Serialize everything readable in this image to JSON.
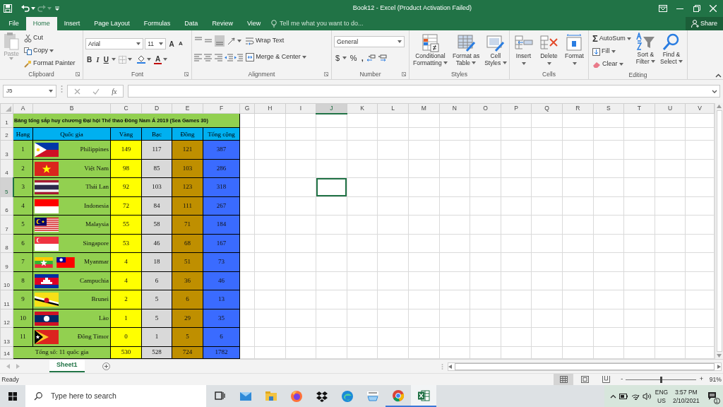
{
  "window": {
    "title": "Book12 - Excel (Product Activation Failed)"
  },
  "ribbon_tabs": [
    {
      "label": "File",
      "selected": false
    },
    {
      "label": "Home",
      "selected": true
    },
    {
      "label": "Insert",
      "selected": false
    },
    {
      "label": "Page Layout",
      "selected": false
    },
    {
      "label": "Formulas",
      "selected": false
    },
    {
      "label": "Data",
      "selected": false
    },
    {
      "label": "Review",
      "selected": false
    },
    {
      "label": "View",
      "selected": false
    }
  ],
  "tell_me": {
    "placeholder": "Tell me what you want to do..."
  },
  "share": "Share",
  "clipboard": {
    "paste": "Paste",
    "cut": "Cut",
    "copy": "Copy",
    "format_painter": "Format Painter",
    "label": "Clipboard"
  },
  "font": {
    "name": "Arial",
    "size": "11",
    "grow": "A",
    "shrink": "A",
    "bold": "B",
    "italic": "I",
    "underline": "U",
    "font_color": "A",
    "label": "Font"
  },
  "alignment": {
    "wrap_text": "Wrap Text",
    "merge_center": "Merge & Center",
    "label": "Alignment"
  },
  "number": {
    "format": "General",
    "currency": "$",
    "percent": "%",
    "comma": ",",
    "label": "Number"
  },
  "styles": {
    "label": "Styles",
    "buttons": [
      {
        "kind": "conditional",
        "lines": [
          "Conditional",
          "Formatting"
        ]
      },
      {
        "kind": "table",
        "lines": [
          "Format as",
          "Table"
        ]
      },
      {
        "kind": "cellstyles",
        "lines": [
          "Cell",
          "Styles"
        ]
      }
    ]
  },
  "cells": {
    "label": "Cells",
    "buttons": [
      {
        "kind": "insert",
        "lines": [
          "Insert"
        ]
      },
      {
        "kind": "delete",
        "lines": [
          "Delete"
        ]
      },
      {
        "kind": "format",
        "lines": [
          "Format"
        ]
      }
    ]
  },
  "editing": {
    "label": "Editing",
    "autosum_symbol": "Σ",
    "autosum": "AutoSum",
    "fill": "Fill",
    "clear": "Clear",
    "buttons": [
      {
        "kind": "sort",
        "lines": [
          "Sort &",
          "Filter"
        ]
      },
      {
        "kind": "find",
        "lines": [
          "Find &",
          "Select"
        ]
      }
    ]
  },
  "name_box": "J5",
  "fx": "fx",
  "columns": [
    {
      "label": "A",
      "selected": false
    },
    {
      "label": "B",
      "selected": false
    },
    {
      "label": "C",
      "selected": false
    },
    {
      "label": "D",
      "selected": false
    },
    {
      "label": "E",
      "selected": false
    },
    {
      "label": "F",
      "selected": false
    },
    {
      "label": "G",
      "selected": false
    },
    {
      "label": "H",
      "selected": false
    },
    {
      "label": "I",
      "selected": false
    },
    {
      "label": "J",
      "selected": true
    },
    {
      "label": "K",
      "selected": false
    },
    {
      "label": "L",
      "selected": false
    },
    {
      "label": "M",
      "selected": false
    },
    {
      "label": "N",
      "selected": false
    },
    {
      "label": "O",
      "selected": false
    },
    {
      "label": "P",
      "selected": false
    },
    {
      "label": "Q",
      "selected": false
    },
    {
      "label": "R",
      "selected": false
    },
    {
      "label": "S",
      "selected": false
    },
    {
      "label": "T",
      "selected": false
    },
    {
      "label": "U",
      "selected": false
    },
    {
      "label": "V",
      "selected": false
    }
  ],
  "row_headers": [
    {
      "label": "1",
      "selected": false
    },
    {
      "label": "2",
      "selected": false
    },
    {
      "label": "3",
      "selected": false
    },
    {
      "label": "4",
      "selected": false
    },
    {
      "label": "5",
      "selected": true
    },
    {
      "label": "6",
      "selected": false
    },
    {
      "label": "7",
      "selected": false
    },
    {
      "label": "8",
      "selected": false
    },
    {
      "label": "9",
      "selected": false
    },
    {
      "label": "10",
      "selected": false
    },
    {
      "label": "11",
      "selected": false
    },
    {
      "label": "12",
      "selected": false
    },
    {
      "label": "13",
      "selected": false
    },
    {
      "label": "14",
      "selected": false
    }
  ],
  "table": {
    "title": "Bảng tổng sắp huy chương Đại hội Thể thao Đông Nam Á 2019 (Sea Games 30)",
    "headers": [
      "Hạng",
      "Quốc gia",
      "Vàng",
      "Bạc",
      "Đồng",
      "Tổng cộng"
    ],
    "rows": [
      {
        "rank": "1",
        "country": "Philippines",
        "flags": [
          {
            "kind": "philippines"
          }
        ],
        "gold": "149",
        "silver": "117",
        "bronze": "121",
        "total": "387"
      },
      {
        "rank": "2",
        "country": "Việt Nam",
        "flags": [
          {
            "kind": "vietnam"
          }
        ],
        "gold": "98",
        "silver": "85",
        "bronze": "103",
        "total": "286"
      },
      {
        "rank": "3",
        "country": "Thái Lan",
        "flags": [
          {
            "kind": "thailand"
          }
        ],
        "gold": "92",
        "silver": "103",
        "bronze": "123",
        "total": "318"
      },
      {
        "rank": "4",
        "country": "Indonesia",
        "flags": [
          {
            "kind": "indonesia"
          }
        ],
        "gold": "72",
        "silver": "84",
        "bronze": "111",
        "total": "267"
      },
      {
        "rank": "5",
        "country": "Malaysia",
        "flags": [
          {
            "kind": "malaysia"
          }
        ],
        "gold": "55",
        "silver": "58",
        "bronze": "71",
        "total": "184"
      },
      {
        "rank": "6",
        "country": "Singapore",
        "flags": [
          {
            "kind": "singapore"
          }
        ],
        "gold": "53",
        "silver": "46",
        "bronze": "68",
        "total": "167"
      },
      {
        "rank": "7",
        "country": "Myanmar",
        "flags": [
          {
            "kind": "myanmar"
          },
          {
            "kind": "taiwan"
          }
        ],
        "gold": "4",
        "silver": "18",
        "bronze": "51",
        "total": "73"
      },
      {
        "rank": "8",
        "country": "Campuchia",
        "flags": [
          {
            "kind": "cambodia"
          }
        ],
        "gold": "4",
        "silver": "6",
        "bronze": "36",
        "total": "46"
      },
      {
        "rank": "9",
        "country": "Brunei",
        "flags": [
          {
            "kind": "brunei"
          }
        ],
        "gold": "2",
        "silver": "5",
        "bronze": "6",
        "total": "13"
      },
      {
        "rank": "10",
        "country": "Lào",
        "flags": [
          {
            "kind": "laos"
          }
        ],
        "gold": "1",
        "silver": "5",
        "bronze": "29",
        "total": "35"
      },
      {
        "rank": "11",
        "country": "Đông Timor",
        "flags": [
          {
            "kind": "timor"
          }
        ],
        "gold": "0",
        "silver": "1",
        "bronze": "5",
        "total": "6"
      }
    ],
    "total_row": {
      "label": "Tổng số: 11 quốc gia",
      "gold": "530",
      "silver": "528",
      "bronze": "724",
      "total": "1782"
    }
  },
  "sheet_tabs": [
    {
      "label": "Sheet1",
      "selected": true
    }
  ],
  "status": {
    "text": "Ready",
    "views": [
      {
        "kind": "normal",
        "selected": true
      },
      {
        "kind": "page_layout",
        "selected": false
      },
      {
        "kind": "page_break",
        "selected": false
      }
    ],
    "zoom": {
      "minus": "-",
      "plus": "+",
      "level": 0.5,
      "reading": "91%"
    }
  },
  "taskbar": {
    "search": {
      "placeholder": "Type here to search"
    },
    "apps": [
      {
        "kind": "taskview",
        "running": false,
        "selected": false
      },
      {
        "kind": "mail",
        "running": false,
        "selected": false
      },
      {
        "kind": "folder",
        "running": false,
        "selected": false
      },
      {
        "kind": "firefox",
        "running": false,
        "selected": false
      },
      {
        "kind": "dropbox",
        "running": false,
        "selected": false
      },
      {
        "kind": "edge",
        "running": false,
        "selected": false
      },
      {
        "kind": "amazon",
        "running": false,
        "selected": false
      },
      {
        "kind": "chrome",
        "running": true,
        "selected": false
      },
      {
        "kind": "excel",
        "running": true,
        "selected": true
      }
    ],
    "tray": {
      "language": "ENG",
      "region": "US",
      "time": "3:57 PM",
      "date": "2/10/2021",
      "notifications": "1"
    }
  }
}
